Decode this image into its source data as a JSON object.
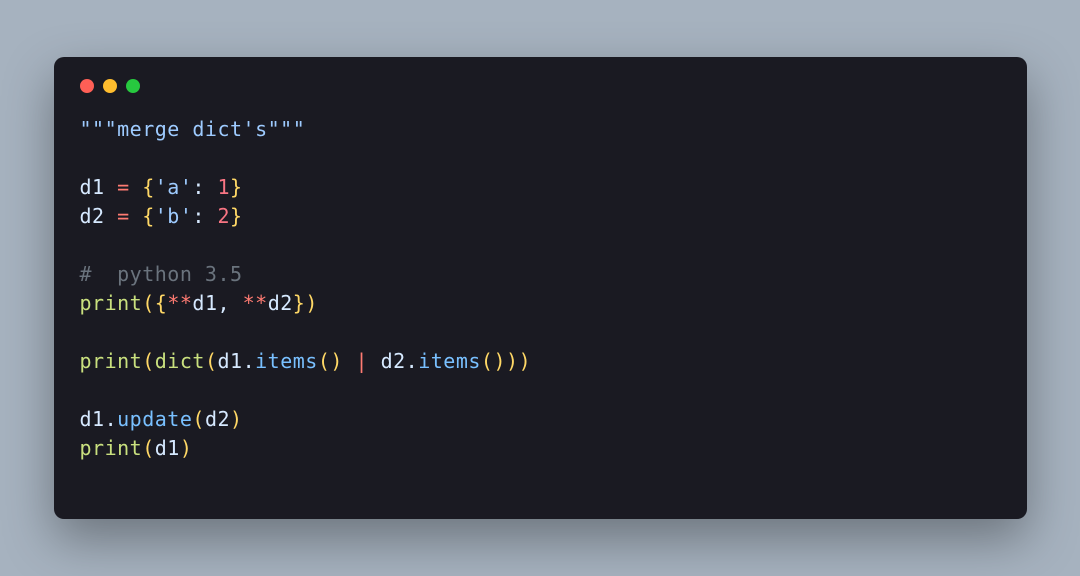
{
  "colors": {
    "background": "#a6b2bf",
    "window_bg": "#1a1a22",
    "dot_red": "#ff5f56",
    "dot_yellow": "#ffbd2e",
    "dot_green": "#27c93f",
    "string": "#9ecbff",
    "variable": "#d6e9ff",
    "operator": "#ff7b72",
    "number": "#f97583",
    "comment": "#6a737d",
    "function": "#c9e07e",
    "punctuation": "#ffd866",
    "property": "#79c0ff"
  },
  "code": {
    "docstring": "\"\"\"merge dict's\"\"\"",
    "line_d1_var": "d1 ",
    "line_d1_eq": "= ",
    "line_d1_brace_open": "{",
    "line_d1_key": "'a'",
    "line_d1_colon": ": ",
    "line_d1_val": "1",
    "line_d1_brace_close": "}",
    "line_d2_var": "d2 ",
    "line_d2_eq": "= ",
    "line_d2_brace_open": "{",
    "line_d2_key": "'b'",
    "line_d2_colon": ": ",
    "line_d2_val": "2",
    "line_d2_brace_close": "}",
    "comment": "#  python 3.5",
    "p1_fn": "print",
    "p1_open": "(",
    "p1_brace_open": "{",
    "p1_star1": "**",
    "p1_d1": "d1",
    "p1_comma": ", ",
    "p1_star2": "**",
    "p1_d2": "d2",
    "p1_brace_close": "}",
    "p1_close": ")",
    "p2_fn": "print",
    "p2_open": "(",
    "p2_dict": "dict",
    "p2_open2": "(",
    "p2_d1": "d1",
    "p2_dot1": ".",
    "p2_items1": "items",
    "p2_paren1": "() ",
    "p2_pipe": "| ",
    "p2_d2": "d2",
    "p2_dot2": ".",
    "p2_items2": "items",
    "p2_paren2": "()",
    "p2_close2": ")",
    "p2_close": ")",
    "u_d1": "d1",
    "u_dot": ".",
    "u_update": "update",
    "u_open": "(",
    "u_d2": "d2",
    "u_close": ")",
    "p3_fn": "print",
    "p3_open": "(",
    "p3_d1": "d1",
    "p3_close": ")"
  }
}
